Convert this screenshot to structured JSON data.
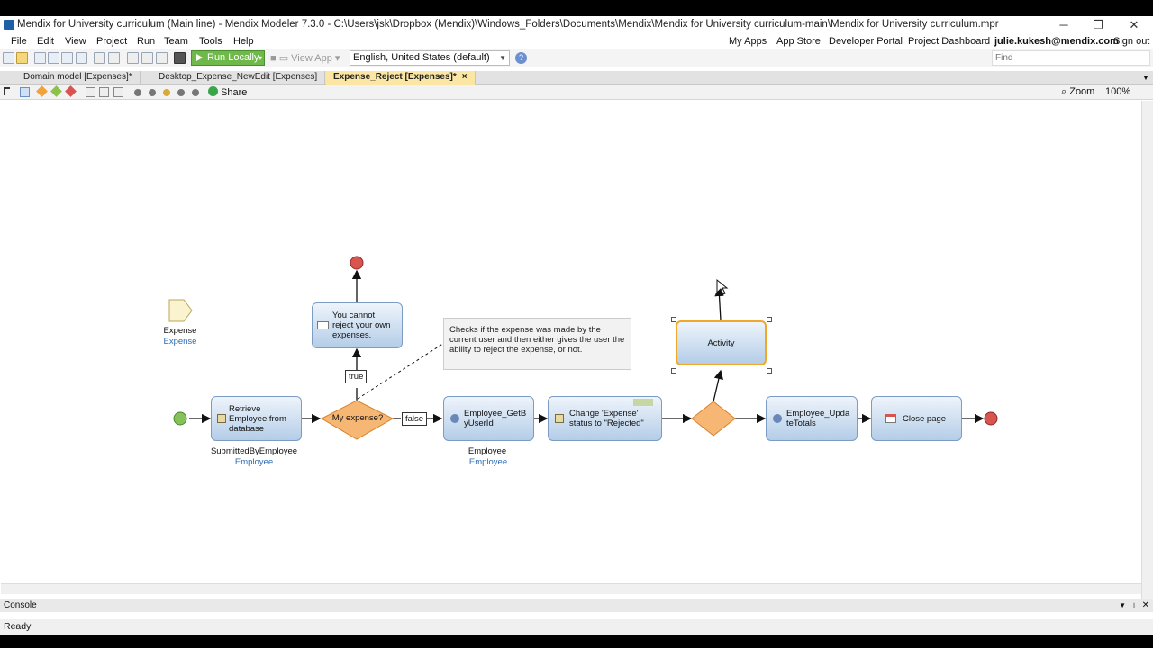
{
  "window": {
    "title": "Mendix for University curriculum (Main line) - Mendix Modeler 7.3.0 - C:\\Users\\jsk\\Dropbox (Mendix)\\Windows_Folders\\Documents\\Mendix\\Mendix for University curriculum-main\\Mendix for University curriculum.mpr",
    "minimize": "─",
    "restore": "❐",
    "close": "✕"
  },
  "menu": {
    "items": [
      "File",
      "Edit",
      "View",
      "Project",
      "Run",
      "Team",
      "Tools",
      "Help"
    ],
    "right_links": [
      "My Apps",
      "App Store",
      "Developer Portal",
      "Project Dashboard"
    ],
    "user": "julie.kukesh@mendix.com",
    "sign_out": "Sign out"
  },
  "toolbar": {
    "run_label": "Run Locally",
    "view_app_label": "View App",
    "language": "English, United States (default)",
    "find_placeholder": "Find",
    "accent": "#6fb94a"
  },
  "tabs": [
    {
      "label": "Domain model [Expenses]*"
    },
    {
      "label": "Desktop_Expense_NewEdit [Expenses]"
    },
    {
      "label": "Expense_Reject [Expenses]*",
      "active": true
    }
  ],
  "tab_close": "×",
  "editor_toolbar": {
    "share_label": "Share",
    "zoom_label": "Zoom",
    "zoom_value": "100%"
  },
  "flow": {
    "parameter": {
      "name": "Expense",
      "type": "Expense"
    },
    "retrieve": {
      "text": "Retrieve Employee from database",
      "var": "SubmittedByEmployee",
      "type": "Employee"
    },
    "decision": {
      "text": "My expense?"
    },
    "true_label": "true",
    "false_label": "false",
    "message": {
      "text": "You cannot reject your own expenses."
    },
    "annotation": "Checks if the expense was made by the current user and then either gives the user the ability to reject the expense, or not.",
    "submicroflow": {
      "text": "Employee_GetByUserId",
      "var": "Employee",
      "type": "Employee"
    },
    "change": {
      "text": "Change 'Expense' status to \"Rejected\""
    },
    "activity": {
      "text": "Activity"
    },
    "update": {
      "text": "Employee_UpdateTotals"
    },
    "close_page": {
      "text": "Close page"
    }
  },
  "console_label": "Console",
  "status_text": "Ready"
}
